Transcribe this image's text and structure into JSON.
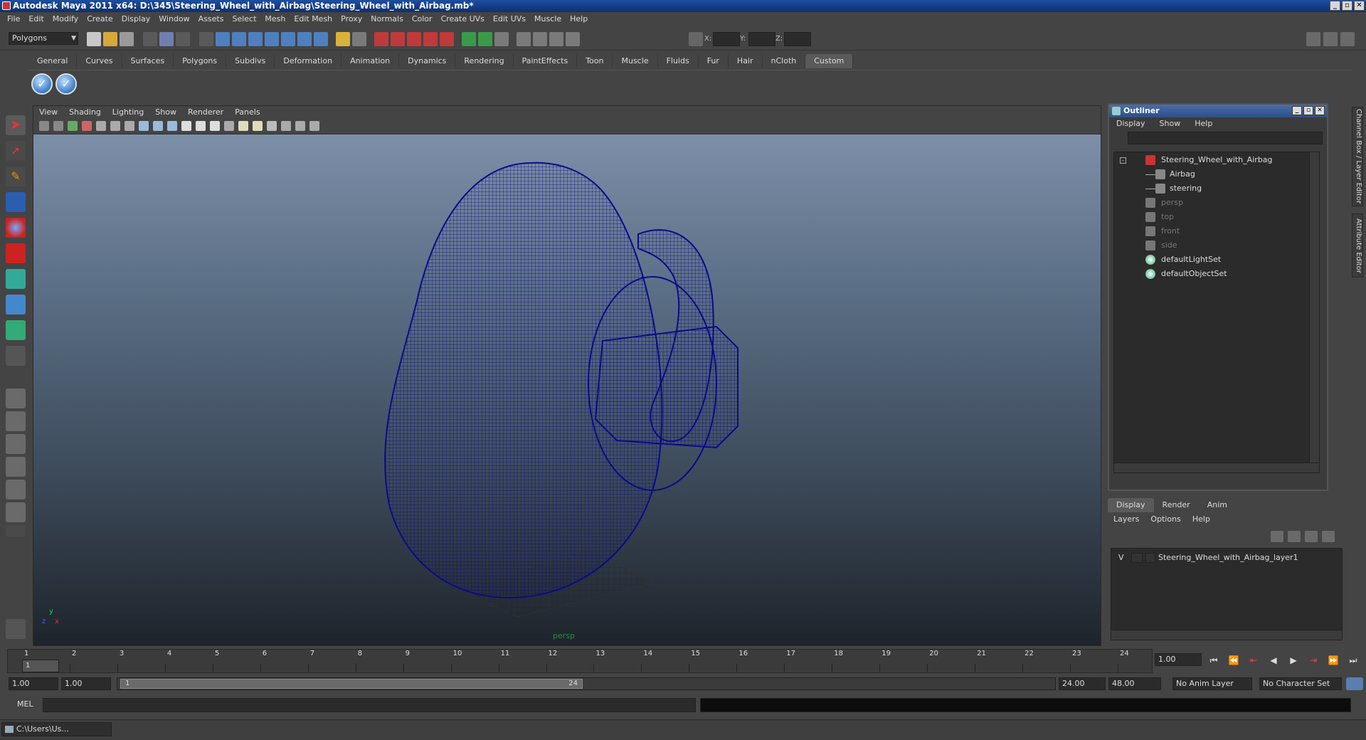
{
  "window": {
    "title": "Autodesk Maya 2011 x64: D:\\345\\Steering_Wheel_with_Airbag\\Steering_Wheel_with_Airbag.mb*"
  },
  "menubar": [
    "File",
    "Edit",
    "Modify",
    "Create",
    "Display",
    "Window",
    "Assets",
    "Select",
    "Mesh",
    "Edit Mesh",
    "Proxy",
    "Normals",
    "Color",
    "Create UVs",
    "Edit UVs",
    "Muscle",
    "Help"
  ],
  "status_line": {
    "mode": "Polygons",
    "coord_labels": {
      "x": "X:",
      "y": "Y:",
      "z": "Z:"
    }
  },
  "shelf": {
    "tabs": [
      "General",
      "Curves",
      "Surfaces",
      "Polygons",
      "Subdivs",
      "Deformation",
      "Animation",
      "Dynamics",
      "Rendering",
      "PaintEffects",
      "Toon",
      "Muscle",
      "Fluids",
      "Fur",
      "Hair",
      "nCloth",
      "Custom"
    ],
    "active_tab": "Custom",
    "buttons": [
      {
        "icon": "checkmark-icon"
      },
      {
        "icon": "checkmark-icon"
      }
    ]
  },
  "viewport": {
    "menu": [
      "View",
      "Shading",
      "Lighting",
      "Show",
      "Renderer",
      "Panels"
    ],
    "camera_label": "persp",
    "axis": {
      "y": "y",
      "x": "x",
      "z": "z"
    }
  },
  "outliner": {
    "title": "Outliner",
    "menu": [
      "Display",
      "Show",
      "Help"
    ],
    "items": [
      {
        "label": "Steering_Wheel_with_Airbag",
        "icon": "group-icon",
        "depth": 0,
        "dim": false
      },
      {
        "label": "Airbag",
        "icon": "mesh-icon",
        "depth": 1,
        "dim": false
      },
      {
        "label": "steering",
        "icon": "mesh-icon",
        "depth": 1,
        "dim": false
      },
      {
        "label": "persp",
        "icon": "camera-icon",
        "depth": 0,
        "dim": true
      },
      {
        "label": "top",
        "icon": "camera-icon",
        "depth": 0,
        "dim": true
      },
      {
        "label": "front",
        "icon": "camera-icon",
        "depth": 0,
        "dim": true
      },
      {
        "label": "side",
        "icon": "camera-icon",
        "depth": 0,
        "dim": true
      },
      {
        "label": "defaultLightSet",
        "icon": "set-icon",
        "depth": 0,
        "dim": false
      },
      {
        "label": "defaultObjectSet",
        "icon": "set-icon",
        "depth": 0,
        "dim": false
      }
    ]
  },
  "layer_editor": {
    "tabs": [
      "Display",
      "Render",
      "Anim"
    ],
    "active_tab": "Display",
    "menu": [
      "Layers",
      "Options",
      "Help"
    ],
    "layers": [
      {
        "visible": "V",
        "name": "Steering_Wheel_with_Airbag_layer1"
      }
    ]
  },
  "side_tabs": [
    "Channel Box / Layer Editor",
    "Attribute Editor"
  ],
  "time_slider": {
    "ticks": [
      "1",
      "2",
      "3",
      "4",
      "5",
      "6",
      "7",
      "8",
      "9",
      "10",
      "11",
      "12",
      "13",
      "14",
      "15",
      "16",
      "17",
      "18",
      "19",
      "20",
      "21",
      "22",
      "23",
      "24"
    ],
    "current_marker": "1",
    "current_frame": "1.00"
  },
  "range_slider": {
    "start_time": "1.00",
    "playback_start": "1.00",
    "range_start_label": "1",
    "range_end_label": "24",
    "playback_end": "24.00",
    "end_time": "48.00",
    "anim_layer": "No Anim Layer",
    "character_set": "No Character Set"
  },
  "command_line": {
    "label": "MEL"
  },
  "taskbar": {
    "item": "C:\\Users\\Us..."
  },
  "colors": {
    "wireframe": "#0a0a8c",
    "title_bar": "#1d4fa0",
    "panel": "#444444"
  }
}
